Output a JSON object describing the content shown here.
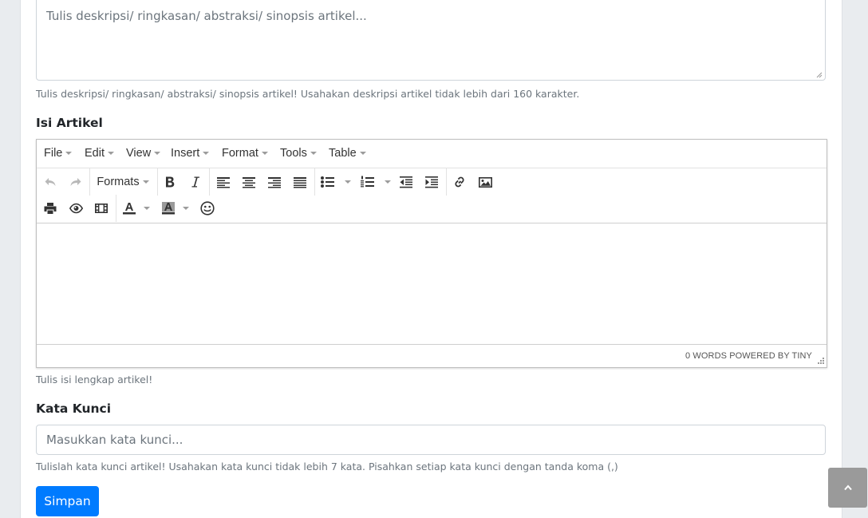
{
  "description": {
    "placeholder": "Tulis deskripsi/ ringkasan/ abstraksi/ sinopsis artikel...",
    "help": "Tulis deskripsi/ ringkasan/ abstraksi/ sinopsis artikel! Usahakan deskripsi artikel tidak lebih dari 160 karakter."
  },
  "content": {
    "label": "Isi Artikel",
    "help": "Tulis isi lengkap artikel!"
  },
  "editor": {
    "menu": [
      "File",
      "Edit",
      "View",
      "Insert",
      "Format",
      "Tools",
      "Table"
    ],
    "formats_label": "Formats",
    "status": "0 WORDS POWERED BY TINY",
    "icons_row1": [
      "undo-icon",
      "redo-icon",
      "formats-dropdown",
      "bold-icon",
      "italic-icon",
      "align-left-icon",
      "align-center-icon",
      "align-right-icon",
      "align-justify-icon",
      "bullet-list-icon",
      "numbered-list-icon",
      "outdent-icon",
      "indent-icon",
      "link-icon",
      "image-icon"
    ],
    "icons_row2": [
      "print-icon",
      "preview-icon",
      "media-icon",
      "text-color-icon",
      "background-color-icon",
      "emoticons-icon"
    ]
  },
  "keywords": {
    "label": "Kata Kunci",
    "placeholder": "Masukkan kata kunci...",
    "help": "Tulislah kata kunci artikel! Usahakan kata kunci tidak lebih 7 kata. Pisahkan setiap kata kunci dengan tanda koma (,)"
  },
  "submit_label": "Simpan",
  "colors": {
    "primary": "#007bff",
    "page_bg": "#e9ecef",
    "back_to_top": "#9a9a9a"
  }
}
